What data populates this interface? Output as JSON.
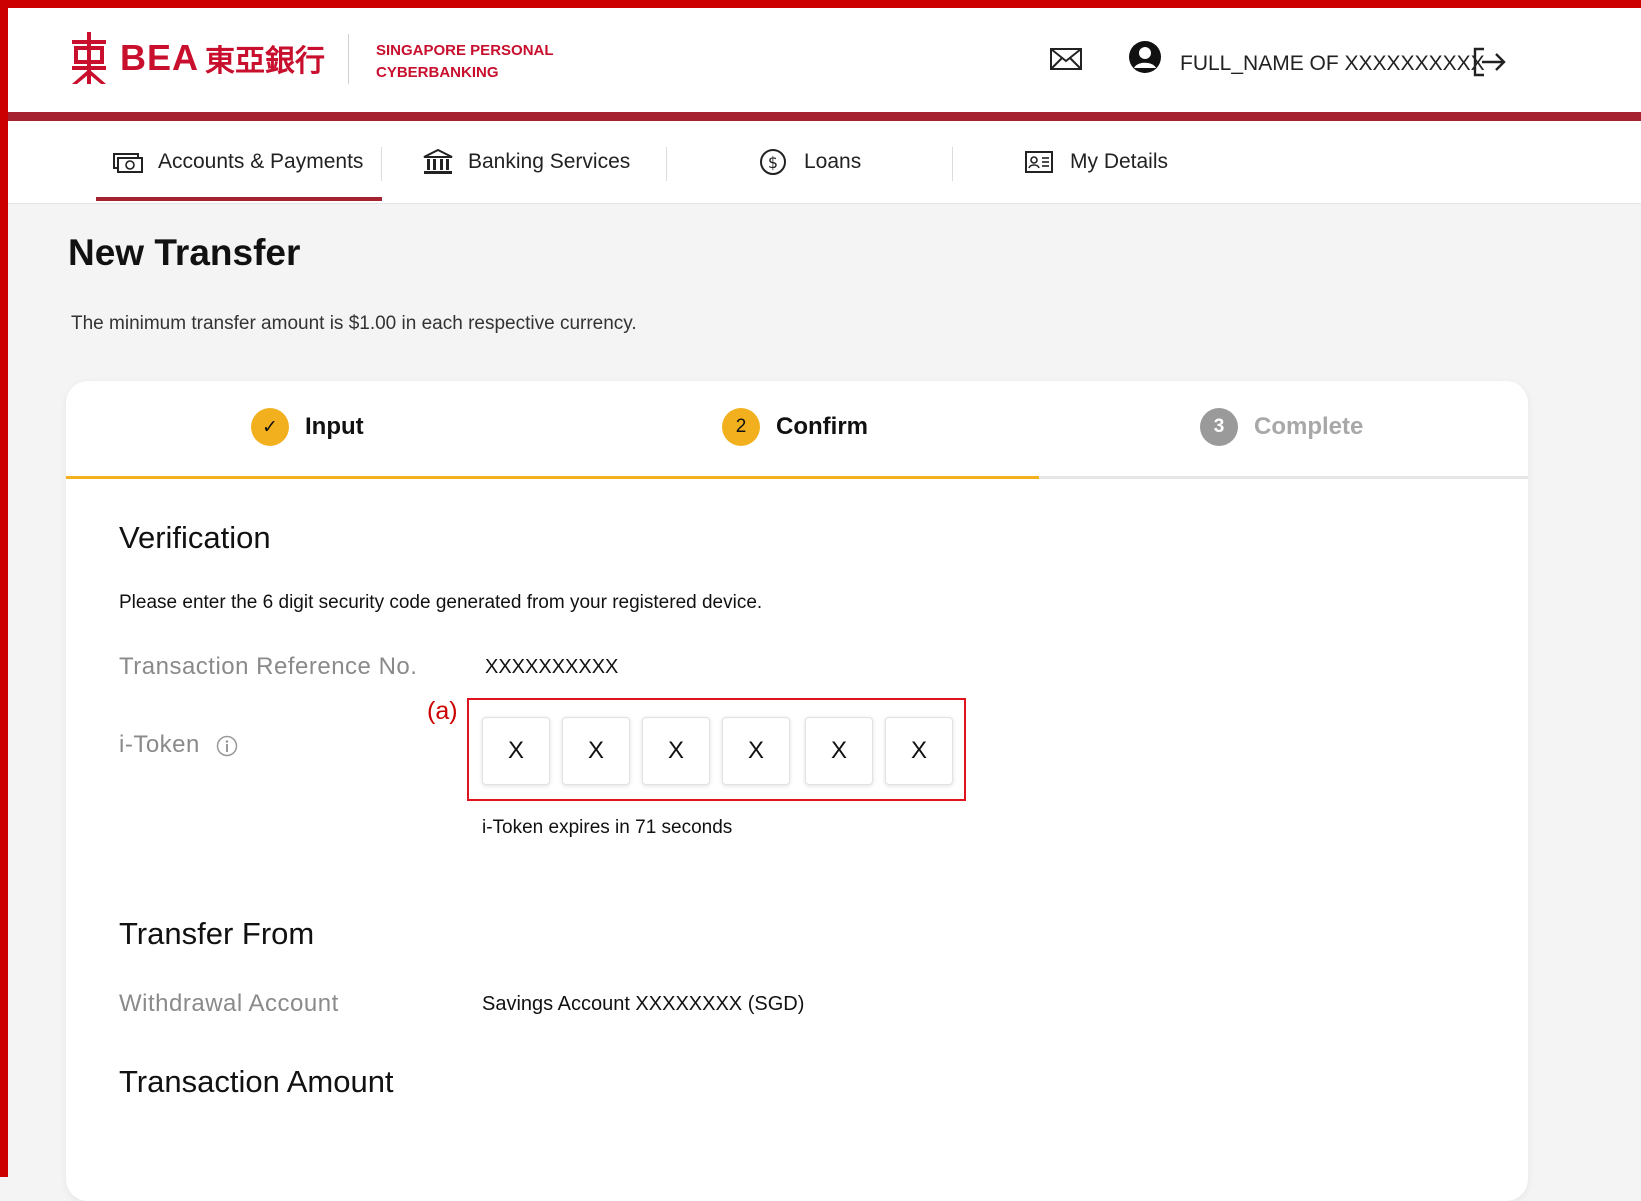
{
  "header": {
    "brand": "BEA",
    "brand_cjk": "東亞銀行",
    "subtitle_line1": "SINGAPORE PERSONAL",
    "subtitle_line2": "CYBERBANKING",
    "user_name": "FULL_NAME OF XXXXXXXXXX"
  },
  "nav": {
    "items": [
      {
        "label": "Accounts & Payments",
        "icon": "cash-icon",
        "active": true
      },
      {
        "label": "Banking Services",
        "icon": "bank-icon",
        "active": false
      },
      {
        "label": "Loans",
        "icon": "dollar-circle-icon",
        "active": false
      },
      {
        "label": "My Details",
        "icon": "id-card-icon",
        "active": false
      }
    ]
  },
  "page": {
    "title": "New Transfer",
    "note": "The minimum transfer amount is $1.00 in each respective currency."
  },
  "stepper": {
    "steps": [
      {
        "label": "Input",
        "marker": "✓",
        "state": "done"
      },
      {
        "label": "Confirm",
        "marker": "2",
        "state": "current"
      },
      {
        "label": "Complete",
        "marker": "3",
        "state": "pending"
      }
    ]
  },
  "verification": {
    "title": "Verification",
    "instruction": "Please enter the 6 digit security code generated from your registered device.",
    "ref_label": "Transaction Reference No.",
    "ref_value": "XXXXXXXXXX",
    "itoken_label": "i-Token",
    "token_digits": [
      "X",
      "X",
      "X",
      "X",
      "X",
      "X"
    ],
    "expiry_text": "i-Token expires in 71 seconds",
    "annotation": "(a)"
  },
  "transfer_from": {
    "title": "Transfer From",
    "label": "Withdrawal Account",
    "value": "Savings Account XXXXXXXX (SGD)"
  },
  "transaction_amount": {
    "title": "Transaction Amount"
  },
  "colors": {
    "brand_red": "#c8102e",
    "accent_yellow": "#f2b01e",
    "header_bar": "#a52330",
    "annotation_red": "#e0141e"
  }
}
